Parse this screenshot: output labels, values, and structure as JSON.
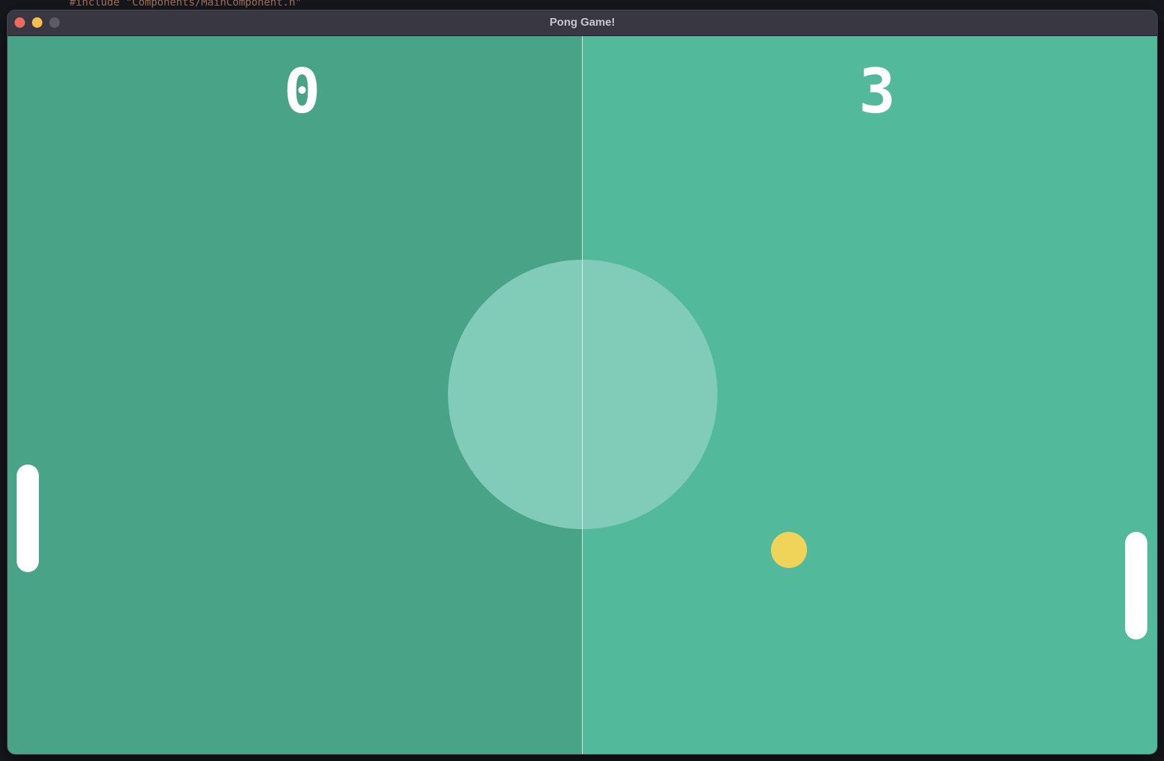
{
  "window": {
    "title": "Pong Game!"
  },
  "background_code": {
    "text": "#include \"Components/MainComponent.h\""
  },
  "scores": {
    "left": "0",
    "right": "3"
  },
  "colors": {
    "left_field": "#49a386",
    "right_field": "#52b99a",
    "center_circle": "#81ccb8",
    "ball": "#f0d45a",
    "paddle": "#ffffff"
  },
  "icons": {
    "close": "close-icon",
    "minimize": "minimize-icon",
    "maximize": "maximize-icon"
  }
}
